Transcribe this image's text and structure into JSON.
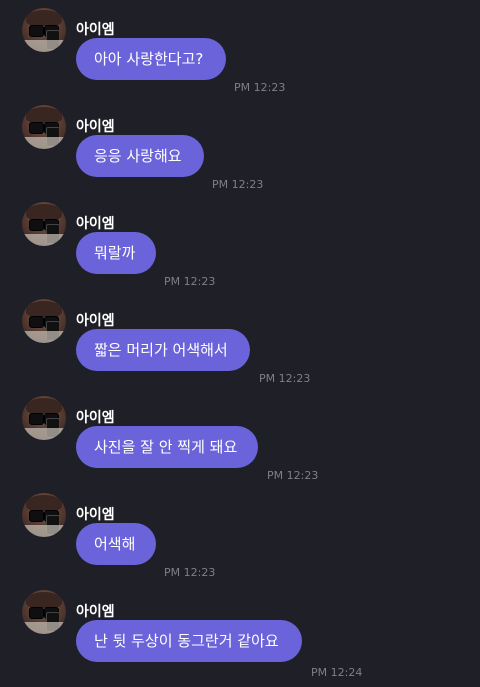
{
  "messages": [
    {
      "sender": "아이엠",
      "text": "아아 사랑한다고?",
      "time": "PM 12:23",
      "avatar_icon": "profile-photo"
    },
    {
      "sender": "아이엠",
      "text": "응응 사랑해요",
      "time": "PM 12:23",
      "avatar_icon": "profile-photo"
    },
    {
      "sender": "아이엠",
      "text": "뭐랄까",
      "time": "PM 12:23",
      "avatar_icon": "profile-photo"
    },
    {
      "sender": "아이엠",
      "text": "짧은 머리가 어색해서",
      "time": "PM 12:23",
      "avatar_icon": "profile-photo"
    },
    {
      "sender": "아이엠",
      "text": "사진을 잘 안 찍게 돼요",
      "time": "PM 12:23",
      "avatar_icon": "profile-photo"
    },
    {
      "sender": "아이엠",
      "text": "어색해",
      "time": "PM 12:23",
      "avatar_icon": "profile-photo"
    },
    {
      "sender": "아이엠",
      "text": "난 뒷 두상이 동그란거 같아요",
      "time": "PM 12:24",
      "avatar_icon": "profile-photo"
    }
  ],
  "colors": {
    "background": "#1e1f27",
    "bubble": "#6b63d9",
    "name": "#ffffff",
    "timestamp": "#7d7f8a"
  }
}
